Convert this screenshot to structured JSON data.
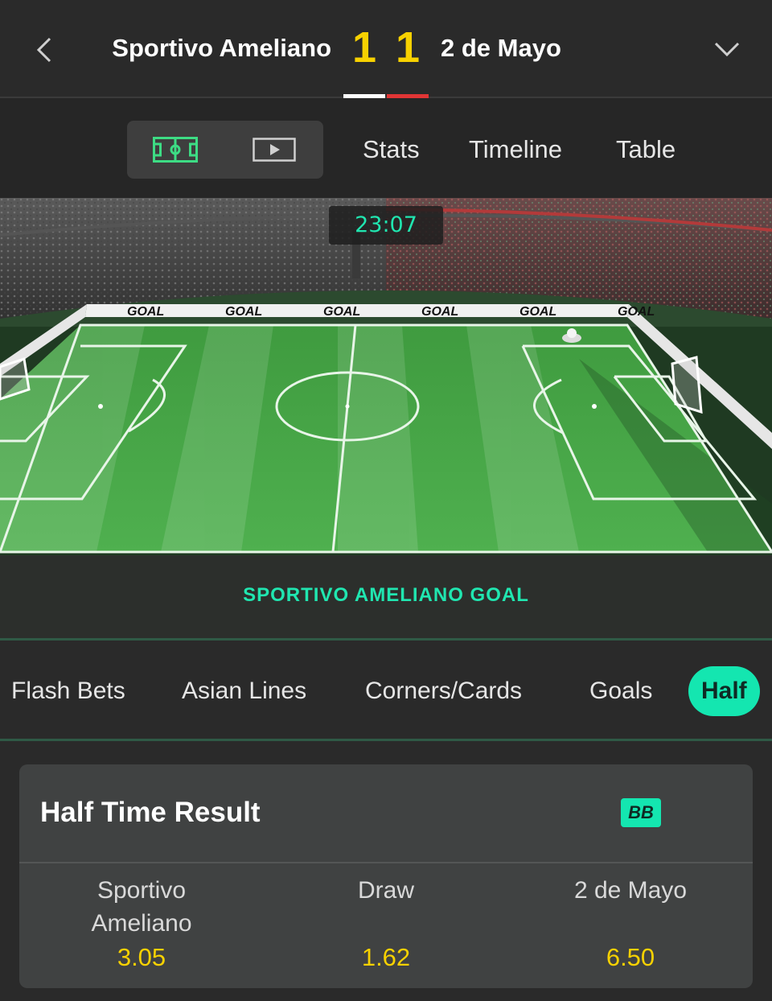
{
  "header": {
    "home_team": "Sportivo Ameliano",
    "away_team": "2 de Mayo",
    "home_score": "1",
    "away_score": "1"
  },
  "subnav": {
    "tabs": [
      "Stats",
      "Timeline",
      "Table"
    ]
  },
  "pitch": {
    "clock": "23:07",
    "board_text": "GOAL",
    "event": "SPORTIVO AMELIANO GOAL"
  },
  "markets": {
    "tabs": [
      "Flash Bets",
      "Asian Lines",
      "Corners/Cards",
      "Goals",
      "Half"
    ],
    "active": "Half"
  },
  "card": {
    "title": "Half Time Result",
    "badge": "BB",
    "outcomes": [
      {
        "line1": "Sportivo",
        "line2": "Ameliano",
        "odds": "3.05"
      },
      {
        "line1": "Draw",
        "line2": "",
        "odds": "1.62"
      },
      {
        "line1": "2 de Mayo",
        "line2": "",
        "odds": "6.50"
      }
    ]
  },
  "colors": {
    "accent": "#14e6b0",
    "score": "#f7d100",
    "home_bar": "#ffffff",
    "away_bar": "#e03535"
  }
}
